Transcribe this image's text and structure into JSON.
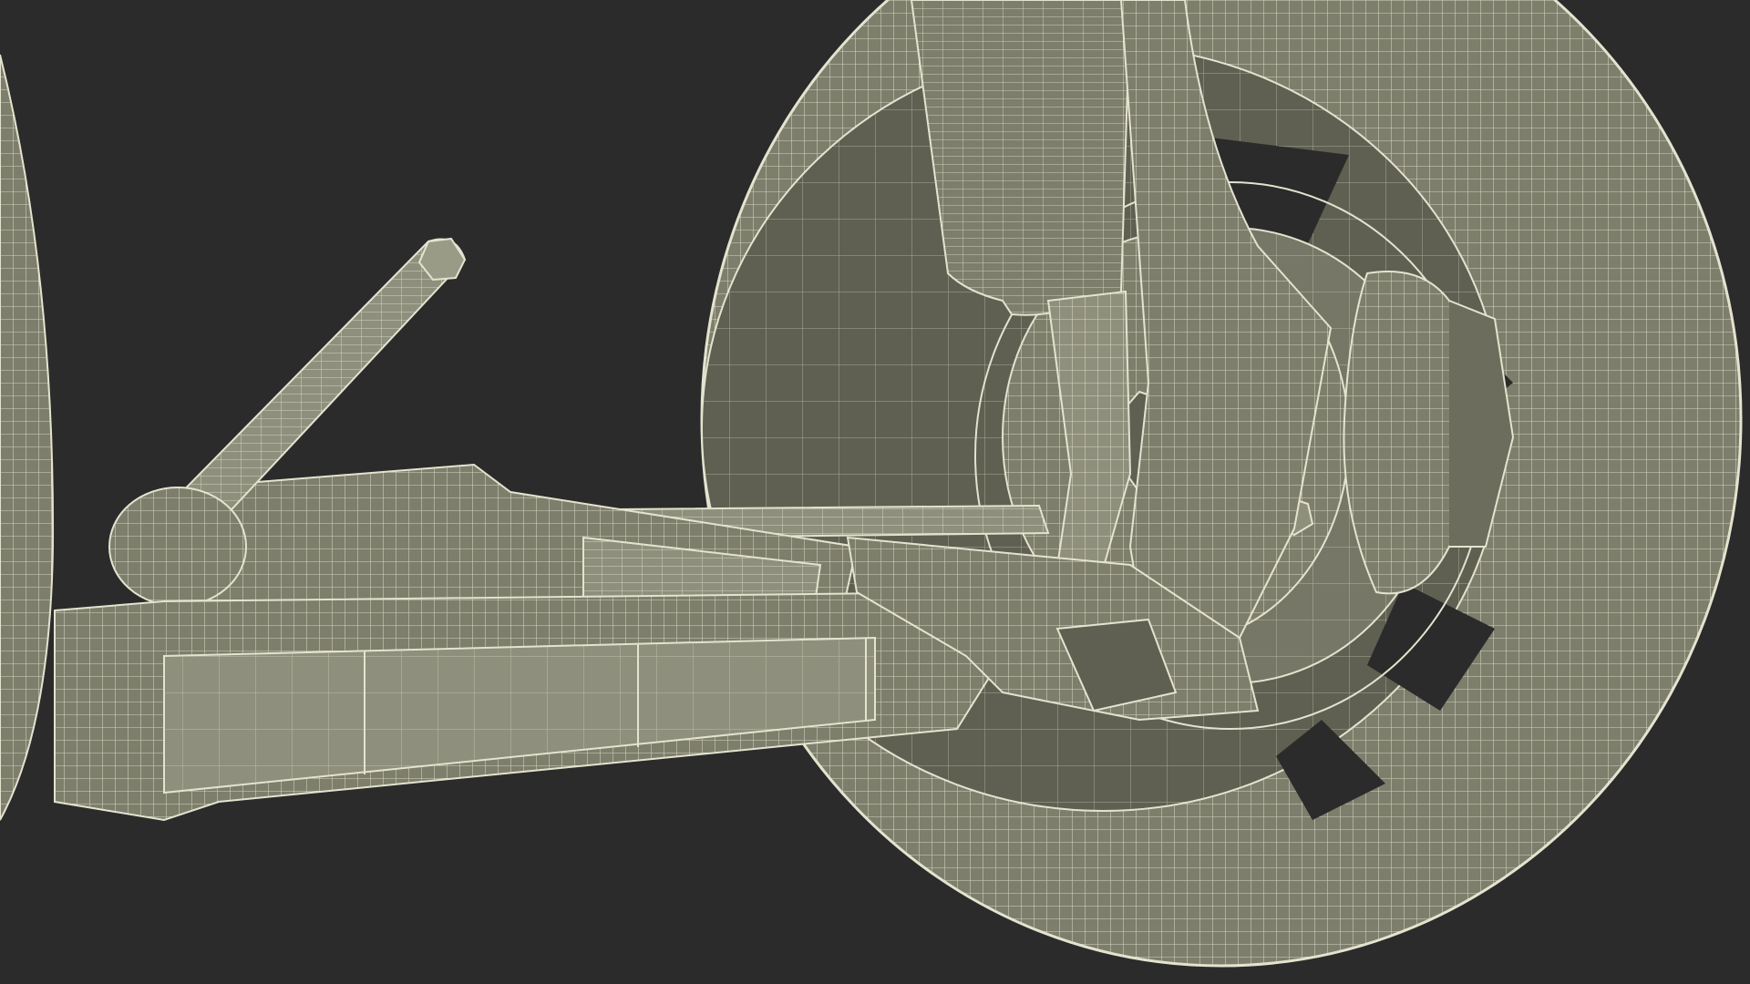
{
  "scene": {
    "subject": "wireframe-car-front-suspension",
    "colors": {
      "background": "#2b2b2b",
      "surface": "#7d7e6c",
      "surface_dark": "#5f6052",
      "surface_light": "#8e8f7c",
      "wire": "#e4e3cf"
    }
  }
}
